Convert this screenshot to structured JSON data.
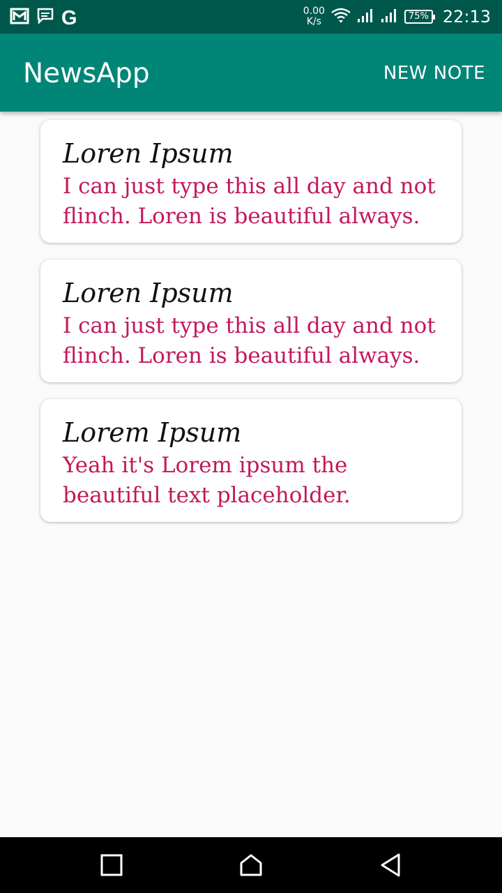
{
  "status_bar": {
    "left_icons": [
      "gmail-icon",
      "message-icon",
      "google-icon"
    ],
    "google_letter": "G",
    "net_speed_value": "0.00",
    "net_speed_unit": "K/s",
    "battery_percent": "75%",
    "time": "22:13"
  },
  "app_bar": {
    "title": "NewsApp",
    "action_label": "NEW NOTE",
    "color": "#008577"
  },
  "notes": [
    {
      "title": "Loren Ipsum",
      "body": "I can just type this all day and not flinch. Loren is beautiful always."
    },
    {
      "title": "Loren Ipsum",
      "body": "I can just type this all day and not flinch. Loren is beautiful always."
    },
    {
      "title": "Lorem Ipsum",
      "body": "Yeah it's Lorem ipsum the beautiful text placeholder."
    }
  ],
  "nav_bar": {
    "buttons": [
      "recents-icon",
      "home-icon",
      "back-icon"
    ]
  },
  "colors": {
    "status_bar": "#00574b",
    "accent_text": "#c2185b",
    "background": "#fafafa"
  }
}
